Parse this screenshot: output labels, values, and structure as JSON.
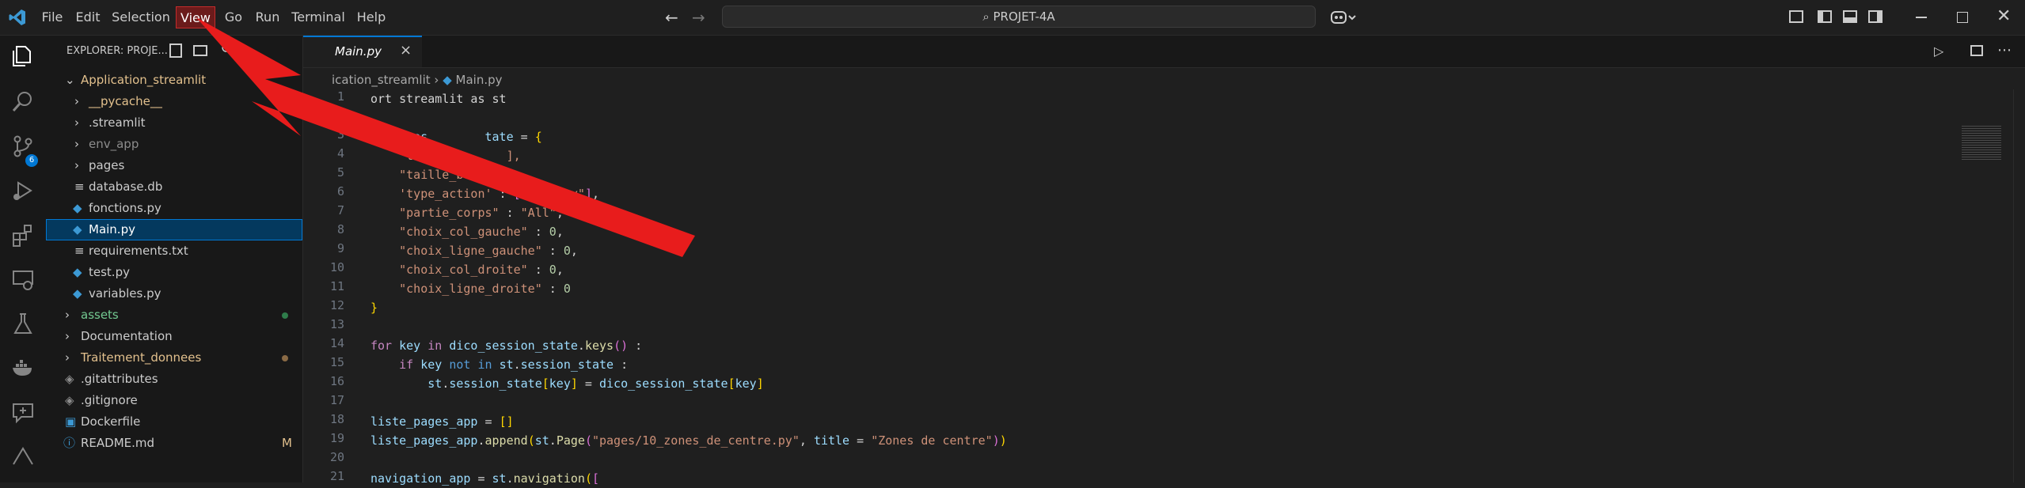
{
  "menu": [
    "File",
    "Edit",
    "Selection",
    "View",
    "Go",
    "Run",
    "Terminal",
    "Help"
  ],
  "search": {
    "text": "PROJET-4A"
  },
  "explorer": {
    "title": "EXPLORER: PROJE..."
  },
  "tree": [
    {
      "label": "Application_streamlit",
      "type": "folder-open"
    },
    {
      "label": "__pycache__",
      "type": "folder"
    },
    {
      "label": ".streamlit",
      "type": "folder"
    },
    {
      "label": "env_app",
      "type": "folder"
    },
    {
      "label": "pages",
      "type": "folder"
    },
    {
      "label": "database.db",
      "type": "file"
    },
    {
      "label": "fonctions.py",
      "type": "py"
    },
    {
      "label": "Main.py",
      "type": "py"
    },
    {
      "label": "requirements.txt",
      "type": "file"
    },
    {
      "label": "test.py",
      "type": "py"
    },
    {
      "label": "variables.py",
      "type": "py"
    },
    {
      "label": "assets",
      "type": "folder"
    },
    {
      "label": "Documentation",
      "type": "folder"
    },
    {
      "label": "Traitement_donnees",
      "type": "folder"
    },
    {
      "label": ".gitattributes",
      "type": "file"
    },
    {
      "label": ".gitignore",
      "type": "file"
    },
    {
      "label": "Dockerfile",
      "type": "file"
    },
    {
      "label": "README.md",
      "type": "file",
      "badge": "M"
    }
  ],
  "tab": {
    "label": "Main.py"
  },
  "breadcrumb": {
    "folder": "ication_streamlit",
    "file": "Main.py"
  },
  "source_control_badge": "6",
  "code_lines": [
    "1",
    "2",
    "3",
    "4",
    "5",
    "6",
    "7",
    "8",
    "9",
    "10",
    "11",
    "12",
    "13",
    "14",
    "15",
    "16",
    "17",
    "18",
    "19",
    "20",
    "21"
  ]
}
